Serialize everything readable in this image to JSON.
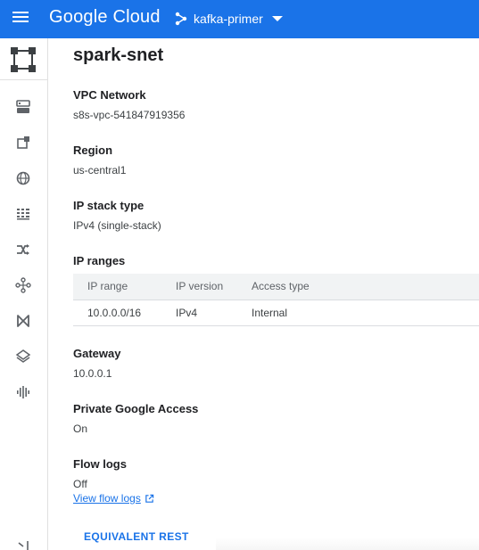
{
  "header": {
    "brand": "Google Cloud",
    "project": "kafka-primer",
    "brand_color": "#1a73e8"
  },
  "rail": {
    "icons": [
      "vpc-logo-icon",
      "server-list-icon",
      "external-box-icon",
      "globe-icon",
      "grid-icon",
      "shuffle-icon",
      "network-nodes-icon",
      "bowtie-icon",
      "layers-icon",
      "waveform-icon"
    ]
  },
  "page": {
    "title": "spark-snet",
    "fields": {
      "vpc_network": {
        "label": "VPC Network",
        "value": "s8s-vpc-541847919356"
      },
      "region": {
        "label": "Region",
        "value": "us-central1"
      },
      "ip_stack": {
        "label": "IP stack type",
        "value": "IPv4 (single-stack)"
      },
      "ip_ranges": {
        "label": "IP ranges"
      },
      "gateway": {
        "label": "Gateway",
        "value": "10.0.0.1"
      },
      "private_access": {
        "label": "Private Google Access",
        "value": "On"
      },
      "flow_logs": {
        "label": "Flow logs",
        "value": "Off"
      }
    },
    "ip_table": {
      "headers": [
        "IP range",
        "IP version",
        "Access type"
      ],
      "rows": [
        [
          "10.0.0.0/16",
          "IPv4",
          "Internal"
        ]
      ]
    },
    "flow_logs_link": "View flow logs",
    "equivalent_rest": "EQUIVALENT REST"
  }
}
